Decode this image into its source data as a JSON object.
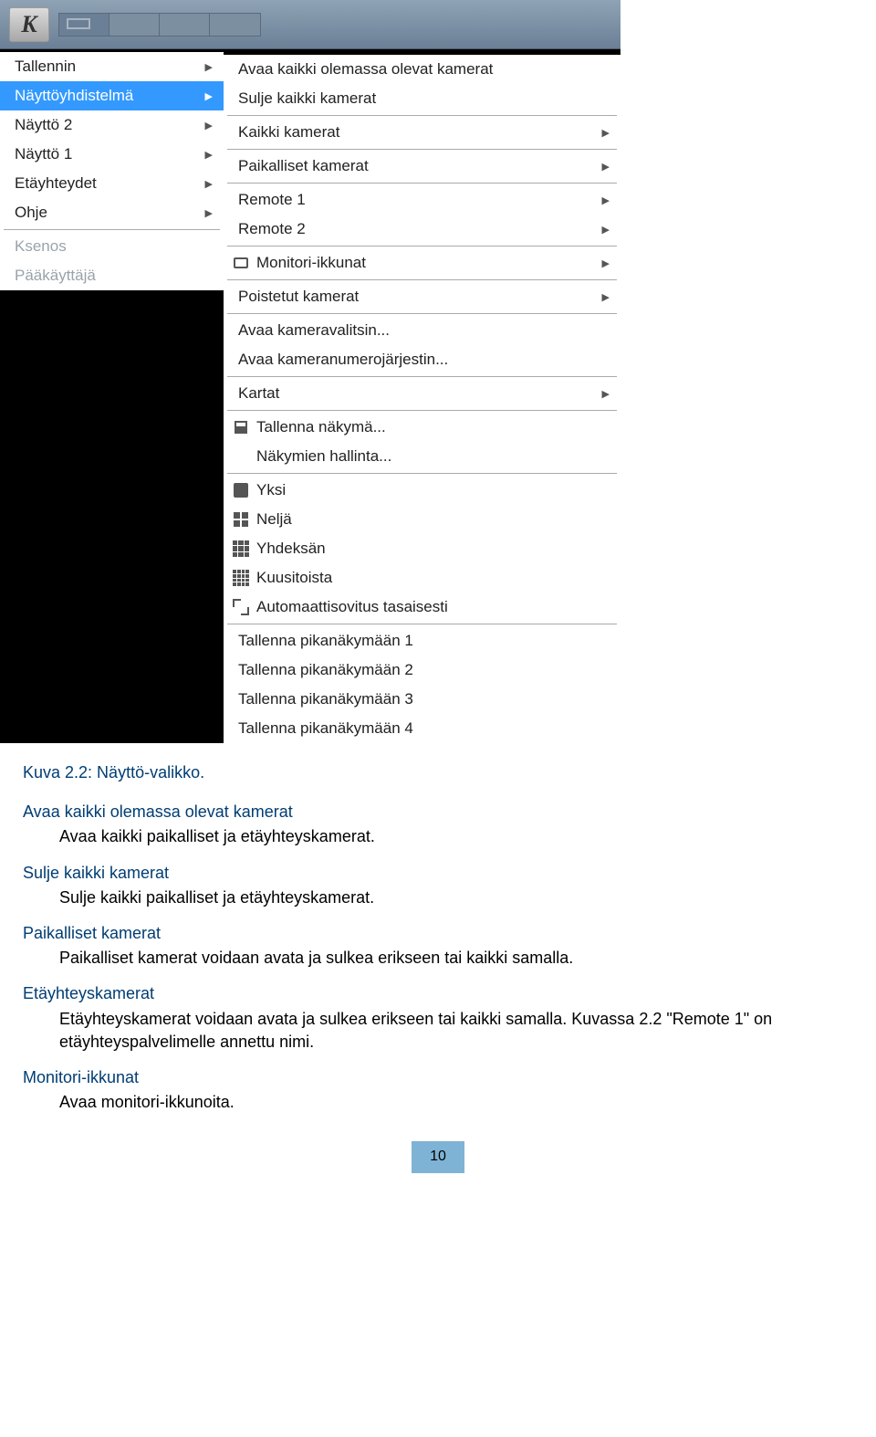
{
  "titlebar": {
    "k_label": "K"
  },
  "menu_left": {
    "items": [
      {
        "label": "Tallennin",
        "arrow": true
      },
      {
        "label": "Näyttöyhdistelmä",
        "arrow": true,
        "selected": true
      },
      {
        "label": "Näyttö 2",
        "arrow": true
      },
      {
        "label": "Näyttö 1",
        "arrow": true
      },
      {
        "label": "Etäyhteydet",
        "arrow": true
      },
      {
        "label": "Ohje",
        "arrow": true
      }
    ],
    "disabled": [
      "Ksenos",
      "Pääkäyttäjä"
    ]
  },
  "submenu": {
    "g1": [
      "Avaa kaikki olemassa olevat kamerat",
      "Sulje kaikki kamerat"
    ],
    "g2": [
      {
        "label": "Kaikki kamerat",
        "arrow": true
      }
    ],
    "g3": [
      {
        "label": "Paikalliset kamerat",
        "arrow": true
      }
    ],
    "g4": [
      {
        "label": "Remote 1",
        "arrow": true
      },
      {
        "label": "Remote 2",
        "arrow": true
      }
    ],
    "g5": [
      {
        "label": "Monitori-ikkunat",
        "arrow": true,
        "icon": "monitor"
      }
    ],
    "g6": [
      {
        "label": "Poistetut kamerat",
        "arrow": true
      }
    ],
    "g7": [
      "Avaa kameravalitsin...",
      "Avaa kameranumerojärjestin..."
    ],
    "g8": [
      {
        "label": "Kartat",
        "arrow": true
      }
    ],
    "g9": [
      {
        "label": "Tallenna näkymä...",
        "icon": "save"
      },
      {
        "label": "Näkymien hallinta..."
      }
    ],
    "g10": [
      {
        "label": "Yksi",
        "icon": "one"
      },
      {
        "label": "Neljä",
        "icon": "four"
      },
      {
        "label": "Yhdeksän",
        "icon": "nine"
      },
      {
        "label": "Kuusitoista",
        "icon": "sixteen"
      },
      {
        "label": "Automaattisovitus tasaisesti",
        "icon": "auto"
      }
    ],
    "g11": [
      "Tallenna pikanäkymään 1",
      "Tallenna pikanäkymään 2",
      "Tallenna pikanäkymään 3",
      "Tallenna pikanäkymään 4"
    ]
  },
  "doc": {
    "caption": "Kuva 2.2: Näyttö-valikko.",
    "sections": [
      {
        "term": "Avaa kaikki olemassa olevat kamerat",
        "desc": "Avaa kaikki paikalliset ja etäyhteyskamerat."
      },
      {
        "term": "Sulje kaikki kamerat",
        "desc": "Sulje kaikki paikalliset ja etäyhteyskamerat."
      },
      {
        "term": "Paikalliset kamerat",
        "desc": "Paikalliset kamerat voidaan avata ja sulkea erikseen tai kaikki samalla."
      },
      {
        "term": "Etäyhteyskamerat",
        "desc": "Etäyhteyskamerat voidaan avata ja sulkea erikseen tai kaikki samalla. Kuvassa 2.2 \"Remote 1\" on etäyhteyspalvelimelle annettu nimi."
      },
      {
        "term": "Monitori-ikkunat",
        "desc": "Avaa monitori-ikkunoita."
      }
    ],
    "page": "10"
  }
}
